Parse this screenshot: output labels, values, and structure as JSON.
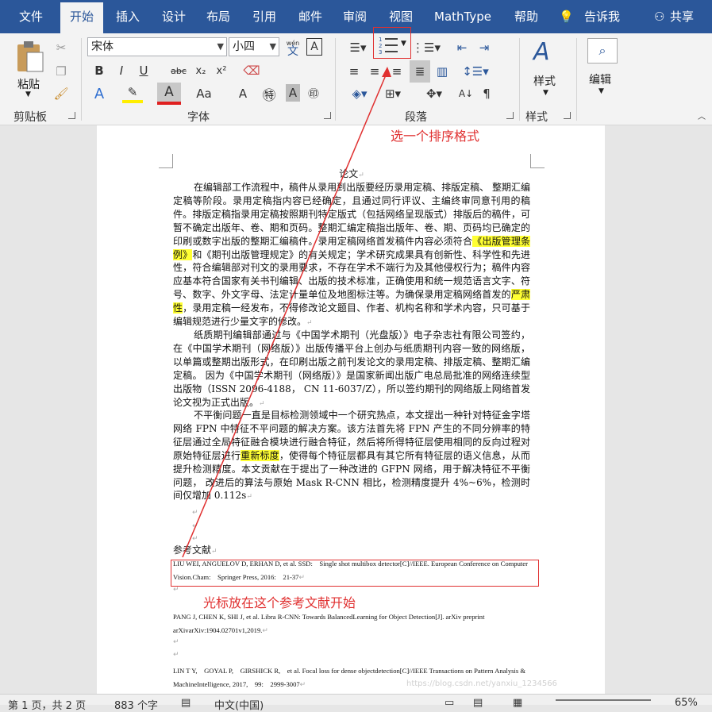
{
  "tabs": [
    "文件",
    "开始",
    "插入",
    "设计",
    "布局",
    "引用",
    "邮件",
    "审阅",
    "视图",
    "MathType",
    "帮助",
    "告诉我",
    "共享"
  ],
  "ribbon": {
    "clipboard": {
      "paste": "粘贴",
      "label": "剪贴板"
    },
    "font": {
      "name": "宋体",
      "size": "小四",
      "label": "字体",
      "wen": "wén",
      "wen2": "文",
      "bold": "B",
      "italic": "I",
      "underline": "U",
      "strike": "abc",
      "sub": "x₂",
      "sup": "x²",
      "case": "Aa",
      "clear_char": "A",
      "A": "A"
    },
    "paragraph": {
      "label": "段落"
    },
    "styles": {
      "btn": "样式",
      "label": "样式"
    },
    "editing": {
      "btn": "编辑"
    }
  },
  "annotations": {
    "top": "选一个排序格式",
    "bottom": "光标放在这个参考文献开始"
  },
  "document": {
    "title": "论文",
    "p1_a": "在编辑部工作流程中，稿件从录用到出版要经历录用定稿、排版定稿、 整期汇编定稿等阶段。录用定稿指内容已经确定，且通过同行评议、主编终审同意刊用的稿件。排版定稿指录用定稿按照期刊特定版式（包括网络呈现版式）排版后的稿件，可暂不确定出版年、卷、期和页码。整期汇编定稿指出版年、卷、期、页码均已确定的印刷或数字出版的整期汇编稿件。录用定稿网络首发稿件内容必须符合",
    "p1_hl1": "《出版管理条例》",
    "p1_b": "和《期刊出版管理规定》的有关规定；学术研究成果具有创新性、科学性和先进性，符合编辑部对刊文的录用要求，不存在学术不端行为及其他侵权行为；稿件内容应基本符合国家有关书刊编辑、出版的技术标准，正确使用和统一规范语言文字、符号、数字、外文字母、法定计量单位及地图标注等。为确保录用定稿网络首发的",
    "p1_hl2": "严肃性",
    "p1_c": "，录用定稿一经发布，不得修改论文题目、作者、机构名称和学术内容，只可基于编辑规范进行少量文字的修改。",
    "p2": "纸质期刊编辑部通过与《中国学术期刊（光盘版）》电子杂志社有限公司签约， 在《中国学术期刊（网络版）》出版传播平台上创办与纸质期刊内容一致的网络版， 以单篇或整期出版形式，在印刷出版之前刊发论文的录用定稿、排版定稿、整期汇编定稿。 因为《中国学术期刊（网络版）》是国家新闻出版广电总局批准的网络连续型出版物（ISSN 2096-4188， CN 11-6037/Z），所以签约期刊的网络版上网络首发论文视为正式出版。",
    "p3_a": "不平衡问题一直是目标检测领域中一个研究热点，本文提出一种针对特征金字塔网络 FPN 中特征不平问题的解决方案。该方法首先将 FPN 产生的不同分辨率的特征层通过全局特征融合模块进行融合特征，然后将所得特征层使用相同的反向过程对原始特征层进行",
    "p3_hl": "重新标度",
    "p3_b": "，使得每个特征层都具有其它所有特征层的语义信息，从而提升检测精度。本文贡献在于提出了一种改进的 GFPN 网络，用于解决特征不平衡问题， 改进后的算法与原始 Mask R-CNN 相比，检测精度提升 4%~6%，检测时间仅增加 0.112s",
    "ref_head": "参考文献",
    "ref1": "LIU WEI, ANGUELOV D, ERHAN D, et al. SSD:　Single shot multibox detector[C]//IEEE. European Conference on Computer Vision.Cham:　Springer Press, 2016:　21-37",
    "ref2": "PANG J, CHEN K, SHI J, et al. Libra R-CNN: Towards BalancedLearning for Object Detection[J]. arXiv preprint arXivarXiv:1904.02701v1,2019.",
    "ref3": "LIN T Y,　GOYAL P,　GIRSHICK R,　et al. Focal loss for dense objectdetection[C]//IEEE Transactions on Pattern Analysis & MachineIntelligence, 2017,　99:　2999-3007"
  },
  "status": {
    "page": "第 1 页，共 2 页",
    "words": "883 个字",
    "lang": "中文(中国)",
    "zoom": "65%"
  },
  "watermark": "https://blog.csdn.net/yanxiu_1234566"
}
